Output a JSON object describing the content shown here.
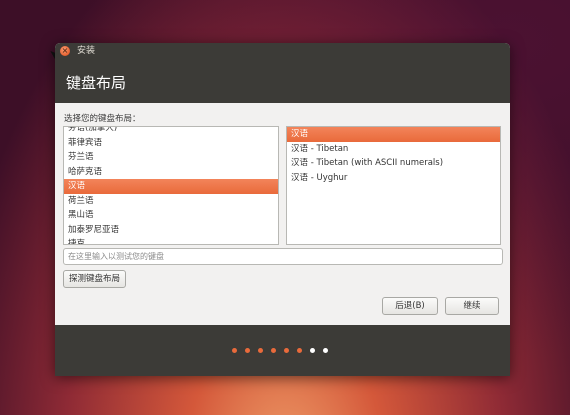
{
  "window": {
    "title": "安装",
    "close_glyph": "×"
  },
  "header": {
    "title": "键盘布局"
  },
  "layout_prompt": "选择您的键盘布局：",
  "layouts": [
    {
      "label": "芬语(加拿大)",
      "selected": false
    },
    {
      "label": "菲律宾语",
      "selected": false
    },
    {
      "label": "芬兰语",
      "selected": false
    },
    {
      "label": "哈萨克语",
      "selected": false
    },
    {
      "label": "汉语",
      "selected": true
    },
    {
      "label": "荷兰语",
      "selected": false
    },
    {
      "label": "黑山语",
      "selected": false
    },
    {
      "label": "加泰罗尼亚语",
      "selected": false
    },
    {
      "label": "捷克",
      "selected": false
    }
  ],
  "variants": [
    {
      "label": "汉语",
      "selected": true
    },
    {
      "label": "汉语 - Tibetan",
      "selected": false
    },
    {
      "label": "汉语 - Tibetan (with ASCII numerals)",
      "selected": false
    },
    {
      "label": "汉语 - Uyghur",
      "selected": false
    }
  ],
  "test_input": {
    "placeholder": "在这里输入以测试您的键盘",
    "value": ""
  },
  "buttons": {
    "detect": "探测键盘布局",
    "back": "后退(B)",
    "continue": "继续"
  },
  "progress": {
    "total_steps": 8,
    "completed_steps": 6,
    "active_color": "#e96a3b",
    "inactive_color": "#ffffff"
  },
  "colors": {
    "accent": "#e96a3b",
    "panel": "#3c3b37"
  }
}
